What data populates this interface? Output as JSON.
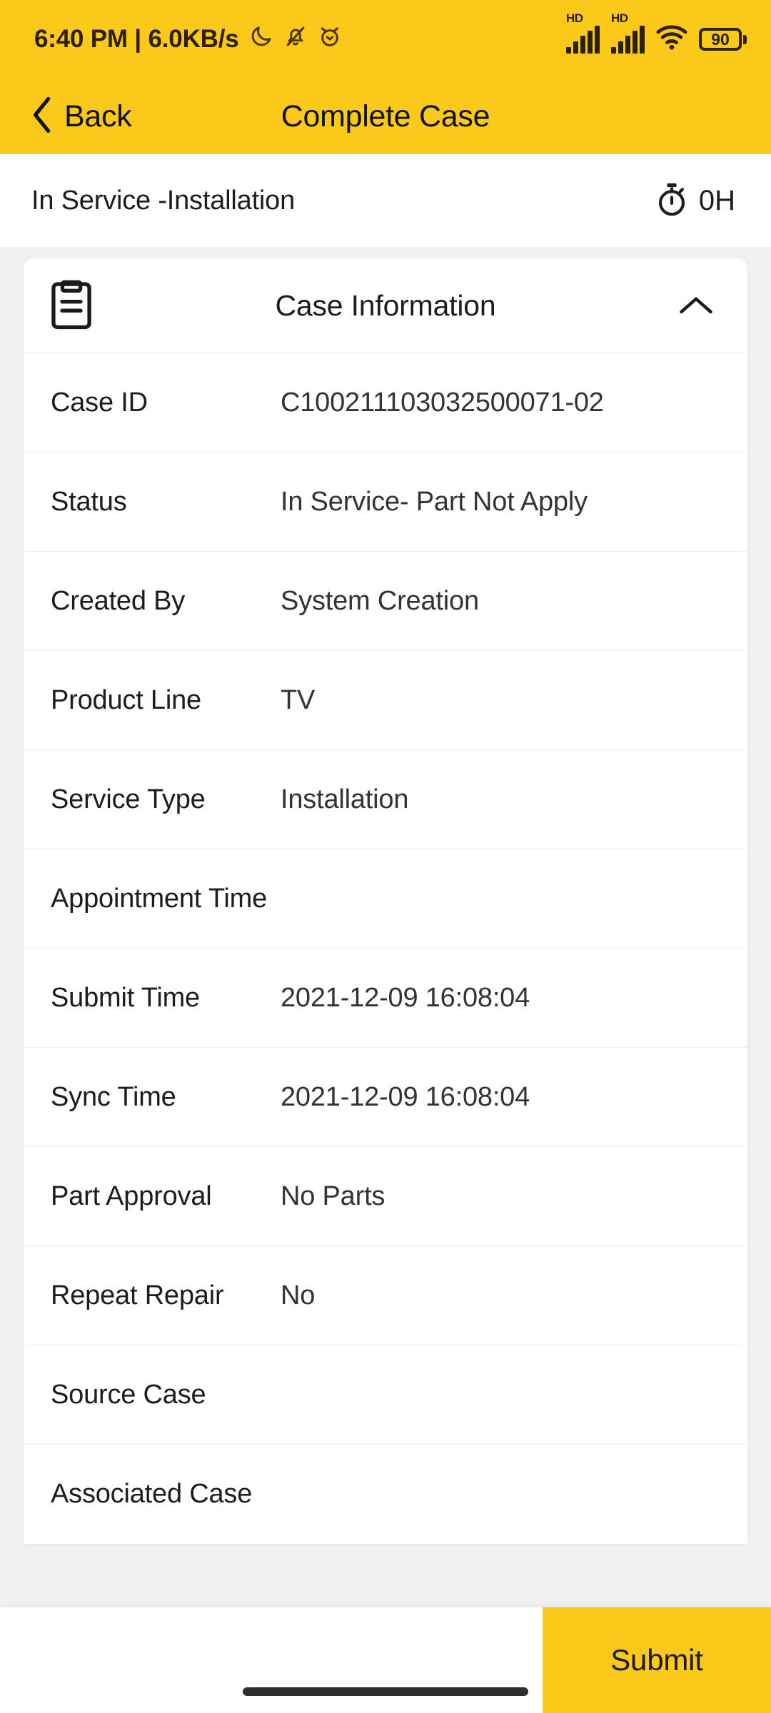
{
  "statusbar": {
    "clock": "6:40 PM | 6.0KB/s",
    "moon_icon": "moon-icon",
    "bell_off_icon": "bell-off-icon",
    "alarm_icon": "alarm-icon",
    "signal1_label": "HD",
    "signal2_label": "HD",
    "wifi_icon": "wifi-icon",
    "battery_level": "90"
  },
  "appbar": {
    "back_label": "Back",
    "title": "Complete Case",
    "background": "#fbc91a"
  },
  "status_strip": {
    "text": "In Service -Installation",
    "timer_icon": "stopwatch-icon",
    "hours": "0H"
  },
  "card": {
    "icon": "clipboard-icon",
    "title": "Case Information",
    "collapse_icon": "chevron-up-icon",
    "rows": [
      {
        "label": "Case ID",
        "value": "C100211103032500071-02"
      },
      {
        "label": "Status",
        "value": "In Service- Part Not Apply"
      },
      {
        "label": "Created By",
        "value": "System Creation"
      },
      {
        "label": "Product Line",
        "value": "TV"
      },
      {
        "label": "Service Type",
        "value": "Installation"
      },
      {
        "label": "Appointment Time",
        "value": ""
      },
      {
        "label": "Submit Time",
        "value": "2021-12-09 16:08:04"
      },
      {
        "label": "Sync Time",
        "value": "2021-12-09 16:08:04"
      },
      {
        "label": "Part Approval",
        "value": "No Parts"
      },
      {
        "label": "Repeat Repair",
        "value": "No"
      },
      {
        "label": "Source Case",
        "value": ""
      },
      {
        "label": "Associated Case",
        "value": ""
      }
    ]
  },
  "bottombar": {
    "submit_label": "Submit",
    "submit_color": "#fbc91a"
  }
}
